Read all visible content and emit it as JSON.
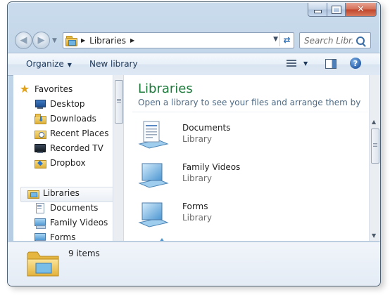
{
  "window": {
    "close_glyph": "✕"
  },
  "address": {
    "crumbs": [
      "Libraries"
    ],
    "search_placeholder": "Search Libr..."
  },
  "toolbar": {
    "organize": "Organize",
    "new_library": "New library",
    "help": "?"
  },
  "nav": {
    "favorites_label": "Favorites",
    "favorites": [
      "Desktop",
      "Downloads",
      "Recent Places",
      "Recorded TV",
      "Dropbox"
    ],
    "libraries_label": "Libraries",
    "libraries": [
      "Documents",
      "Family Videos",
      "Forms"
    ]
  },
  "content": {
    "title": "Libraries",
    "subtitle": "Open a library to see your files and arrange them by fold...",
    "items": [
      {
        "name": "Documents",
        "type": "Library",
        "icon": "documents-library-icon"
      },
      {
        "name": "Family Videos",
        "type": "Library",
        "icon": "library-icon"
      },
      {
        "name": "Forms",
        "type": "Library",
        "icon": "library-icon"
      }
    ]
  },
  "details": {
    "count": "9 items"
  },
  "colors": {
    "title_green": "#1e7b3c",
    "accent_blue": "#2c6fb5",
    "frame": "#bcd1e6"
  }
}
